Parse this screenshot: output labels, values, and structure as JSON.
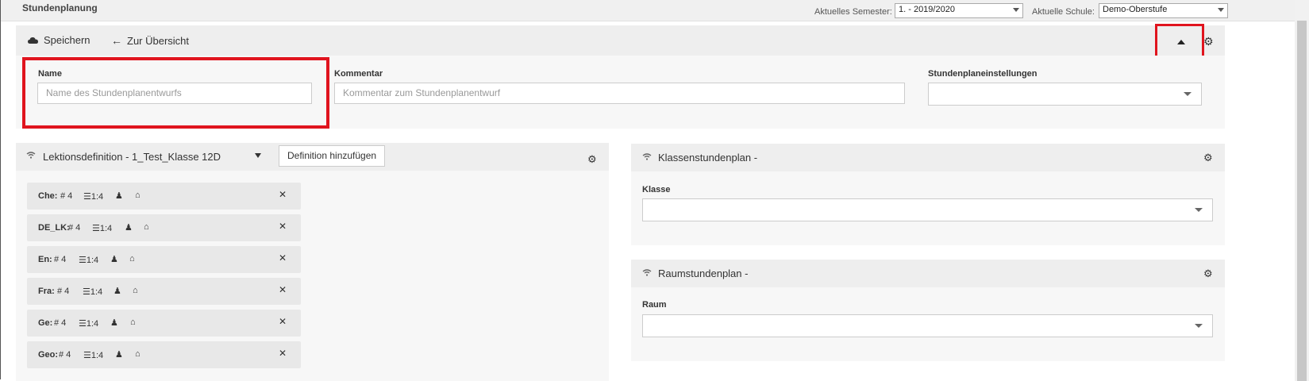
{
  "page_title": "Stundenplanung",
  "header": {
    "semester_label": "Aktuelles Semester:",
    "semester_value": "1. - 2019/2020",
    "school_label": "Aktuelle Schule:",
    "school_value": "Demo-Oberstufe"
  },
  "toolbar": {
    "save_label": "Speichern",
    "overview_label": "Zur Übersicht"
  },
  "form": {
    "name_label": "Name",
    "name_placeholder": "Name des Stundenplanentwurfs",
    "comment_label": "Kommentar",
    "comment_placeholder": "Kommentar zum Stundenplanentwurf",
    "settings_label": "Stundenplaneinstellungen",
    "settings_value": ""
  },
  "lesson_panel": {
    "title": "Lektionsdefinition -  1_Test_Klasse 12D",
    "add_button": "Definition hinzufügen",
    "lessons": [
      {
        "subject": "Che:",
        "count": "# 4",
        "ratio": "1:4"
      },
      {
        "subject": "DE_LK:",
        "count": "# 4",
        "ratio": "1:4"
      },
      {
        "subject": "En:",
        "count": "# 4",
        "ratio": "1:4"
      },
      {
        "subject": "Fra:",
        "count": "# 4",
        "ratio": "1:4"
      },
      {
        "subject": "Ge:",
        "count": "# 4",
        "ratio": "1:4"
      },
      {
        "subject": "Geo:",
        "count": "# 4",
        "ratio": "1:4"
      }
    ]
  },
  "class_panel": {
    "title": "Klassenstundenplan -",
    "field_label": "Klasse",
    "field_value": ""
  },
  "room_panel": {
    "title": "Raumstundenplan -",
    "field_label": "Raum",
    "field_value": ""
  },
  "colors": {
    "highlight": "#e0141e",
    "panel_header": "#eeeeee",
    "panel_body": "#f7f7f7"
  },
  "icons": [
    "cloud-icon",
    "arrow-left-icon",
    "caret-up-icon",
    "gear-icon",
    "wifi-icon",
    "caret-down-icon",
    "list-icon",
    "user-icon",
    "home-icon",
    "close-icon"
  ]
}
